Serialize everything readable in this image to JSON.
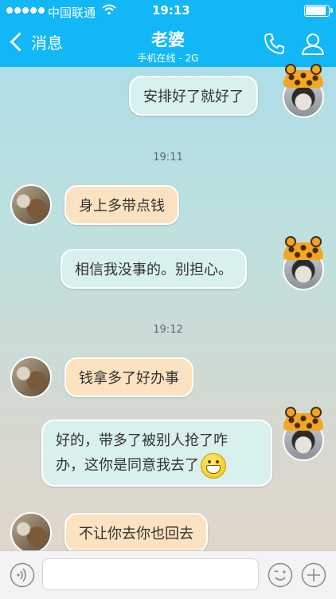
{
  "status_bar": {
    "carrier": "中国联通",
    "time": "19:13",
    "battery_level": 0.9
  },
  "nav": {
    "back_label": "消息",
    "title": "老婆",
    "subtitle": "手机在线 - 2G",
    "icons": [
      "back-chevron-icon",
      "phone-icon",
      "profile-icon"
    ]
  },
  "chat": {
    "messages": [
      {
        "sender": "me",
        "text": "安排好了就好了"
      },
      {
        "type": "time",
        "text": "19:11"
      },
      {
        "sender": "her",
        "text": "身上多带点钱"
      },
      {
        "sender": "me",
        "text": "相信我没事的。别担心。"
      },
      {
        "type": "time",
        "text": "19:12"
      },
      {
        "sender": "her",
        "text": "钱拿多了好办事"
      },
      {
        "sender": "me",
        "line1": "好的，带多了被别人抢了咋",
        "line2": "办，这你是同意我去了",
        "emoji": "grin-emoji"
      },
      {
        "sender": "her",
        "text": "不让你去你也回去"
      }
    ]
  },
  "input_bar": {
    "placeholder": "",
    "icons": [
      "voice-icon",
      "emoji-icon",
      "plus-icon"
    ]
  },
  "colors": {
    "accent": "#12b7f5",
    "bubble_out": "#d9f1ee",
    "bubble_in": "#fbe2c1"
  }
}
